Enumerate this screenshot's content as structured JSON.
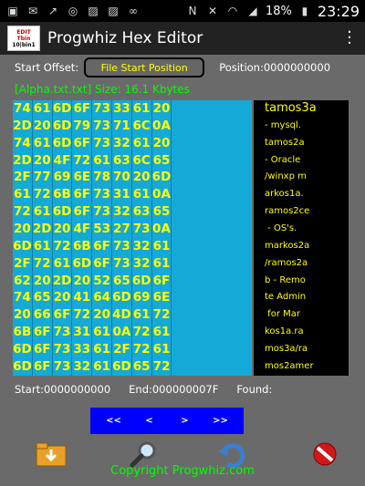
{
  "status_bar": {
    "battery": "18%",
    "time": "23:29",
    "icons_left": [
      "sim-icon",
      "mail-icon",
      "missed-call-icon",
      "broadcast-icon",
      "photo-icon",
      "photo-icon",
      "voicemail-icon"
    ],
    "icons_right": [
      "nfc-icon",
      "mute-icon",
      "wifi-icon",
      "signal-icon",
      "battery-icon"
    ]
  },
  "app": {
    "title": "Progwhiz Hex Editor",
    "logo_line1": "EDIT",
    "logo_line2": "Tbin",
    "logo_line3": "10|bin1"
  },
  "offset": {
    "label": "Start Offset:",
    "button": "File Start Position",
    "position": "Position:0000000000"
  },
  "file_info": "[Alpha.txt.txt] Size: 16.1 Kbytes",
  "hex_rows": [
    [
      "74",
      "61",
      "6D",
      "6F",
      "73",
      "33",
      "61",
      "20"
    ],
    [
      "2D",
      "20",
      "6D",
      "79",
      "73",
      "71",
      "6C",
      "0A"
    ],
    [
      "74",
      "61",
      "6D",
      "6F",
      "73",
      "32",
      "61",
      "20"
    ],
    [
      "2D",
      "20",
      "4F",
      "72",
      "61",
      "63",
      "6C",
      "65"
    ],
    [
      "2F",
      "77",
      "69",
      "6E",
      "78",
      "70",
      "20",
      "6D"
    ],
    [
      "61",
      "72",
      "6B",
      "6F",
      "73",
      "31",
      "61",
      "0A"
    ],
    [
      "72",
      "61",
      "6D",
      "6F",
      "73",
      "32",
      "63",
      "65"
    ],
    [
      "20",
      "2D",
      "20",
      "4F",
      "53",
      "27",
      "73",
      "0A"
    ],
    [
      "6D",
      "61",
      "72",
      "6B",
      "6F",
      "73",
      "32",
      "61"
    ],
    [
      "2F",
      "72",
      "61",
      "6D",
      "6F",
      "73",
      "32",
      "61"
    ],
    [
      "62",
      "20",
      "2D",
      "20",
      "52",
      "65",
      "6D",
      "6F"
    ],
    [
      "74",
      "65",
      "20",
      "41",
      "64",
      "6D",
      "69",
      "6E"
    ],
    [
      "20",
      "66",
      "6F",
      "72",
      "20",
      "4D",
      "61",
      "72"
    ],
    [
      "6B",
      "6F",
      "73",
      "31",
      "61",
      "0A",
      "72",
      "61"
    ],
    [
      "6D",
      "6F",
      "73",
      "33",
      "61",
      "2F",
      "72",
      "61"
    ],
    [
      "6D",
      "6F",
      "73",
      "32",
      "61",
      "6D",
      "65",
      "72"
    ]
  ],
  "ascii_rows": [
    "tamos3a",
    "- mysql.",
    "tamos2a",
    "- Oracle",
    "/winxp m",
    "arkos1a.",
    "ramos2ce",
    " - OS's.",
    "markos2a",
    "/ramos2a",
    "b - Remo",
    "te Admin",
    " for Mar",
    "kos1a.ra",
    "mos3a/ra",
    "mos2amer"
  ],
  "range": {
    "start": "Start:0000000000",
    "end": "End:000000007F",
    "found": "Found:"
  },
  "nav": {
    "first": "<<",
    "prev": "<",
    "next": ">",
    "last": ">>"
  },
  "copyright": "Copyright Progwhiz.com",
  "colors": {
    "hex_bg": "#15a9d8",
    "hex_text": "#ffff00",
    "ascii_bg": "#000000",
    "nav_bg": "#0000ff",
    "info_text": "#00ff00"
  }
}
